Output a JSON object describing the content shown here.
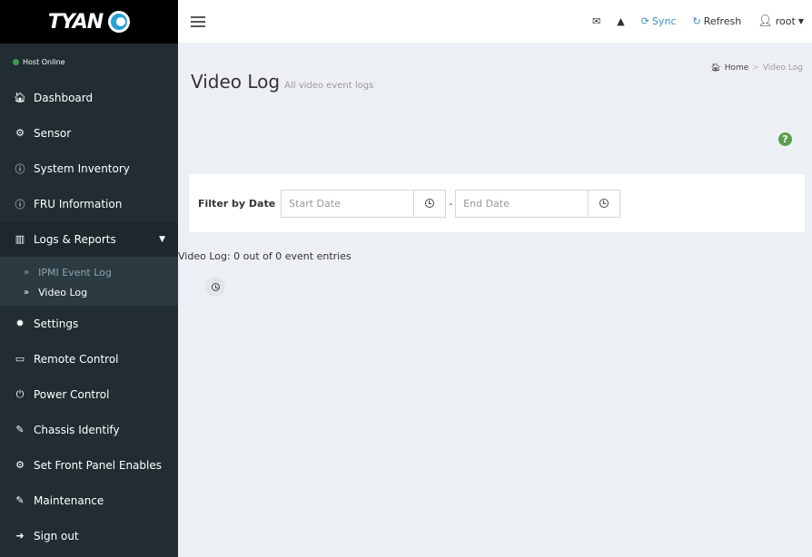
{
  "brand": {
    "name": "TYAN"
  },
  "status": {
    "text": "Host Online",
    "color": "#3c9a4a"
  },
  "sidebar": {
    "items": [
      {
        "label": "Dashboard",
        "icon": "home-icon"
      },
      {
        "label": "Sensor",
        "icon": "sensor-icon"
      },
      {
        "label": "System Inventory",
        "icon": "info-icon"
      },
      {
        "label": "FRU Information",
        "icon": "info-icon"
      },
      {
        "label": "Logs & Reports",
        "icon": "bar-chart-icon"
      },
      {
        "label": "Settings",
        "icon": "gear-icon"
      },
      {
        "label": "Remote Control",
        "icon": "monitor-icon"
      },
      {
        "label": "Power Control",
        "icon": "power-icon"
      },
      {
        "label": "Chassis Identify",
        "icon": "wand-icon"
      },
      {
        "label": "Set Front Panel Enables",
        "icon": "gears-icon"
      },
      {
        "label": "Maintenance",
        "icon": "wrench-icon"
      },
      {
        "label": "Sign out",
        "icon": "sign-out-icon"
      }
    ],
    "submenu": [
      {
        "label": "IPMI Event Log"
      },
      {
        "label": "Video Log"
      }
    ]
  },
  "topbar": {
    "sync_label": "Sync",
    "refresh_label": "Refresh",
    "user_label": "root"
  },
  "page": {
    "title": "Video Log",
    "subtitle": "All video event logs"
  },
  "breadcrumb": {
    "home": "Home",
    "current": "Video Log"
  },
  "filter": {
    "label": "Filter by Date",
    "start_placeholder": "Start Date",
    "end_placeholder": "End Date",
    "separator": "-"
  },
  "entries": {
    "text": "Video Log: 0 out of 0 event entries"
  },
  "colors": {
    "sidebar_bg": "#222d32",
    "accent": "#3c8dbc",
    "help": "#5a9e4f"
  }
}
